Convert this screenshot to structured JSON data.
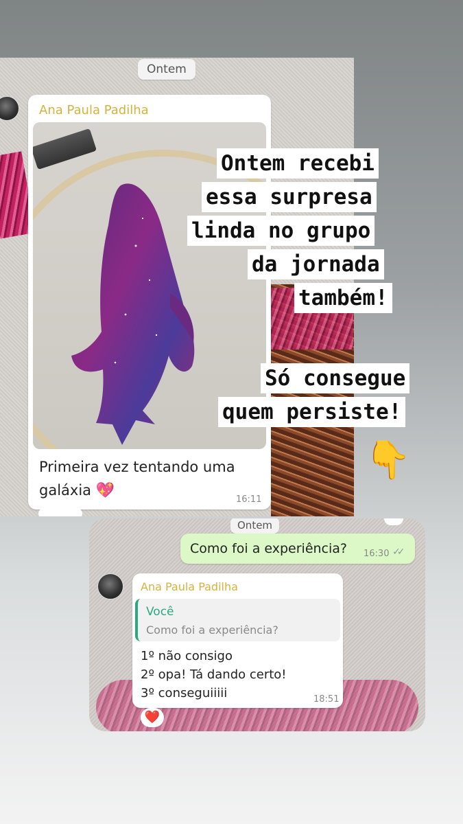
{
  "top_chat": {
    "date_chip": "Ontem",
    "sender": "Ana Paula Padilha",
    "caption_line1": "Primeira vez tentando uma",
    "caption_line2": "galáxia",
    "emoji": "💖",
    "time": "16:11"
  },
  "overlay": {
    "line1": "Ontem recebi",
    "line2": "essa surpresa",
    "line3": "linda no grupo",
    "line4": "da jornada",
    "line5": "também!",
    "line6": "Só consegue",
    "line7": "quem persiste!",
    "pointing_emoji": "👇"
  },
  "bottom_chat": {
    "date_chip": "Ontem",
    "outgoing_text": "Como foi a experiência?",
    "outgoing_time": "16:30",
    "sender": "Ana Paula Padilha",
    "reply_author": "Você",
    "reply_text": "Como foi a experiência?",
    "line1": "1º não consigo",
    "line2": "2º opa! Tá dando certo!",
    "line3": "3º conseguiiiii",
    "time": "18:51",
    "reaction": "❤️"
  },
  "colors": {
    "sender_name": "#d4b33c",
    "outgoing_bubble": "#dcf8c6",
    "reply_accent": "#2aa87f",
    "whale": "#7a2a78"
  }
}
